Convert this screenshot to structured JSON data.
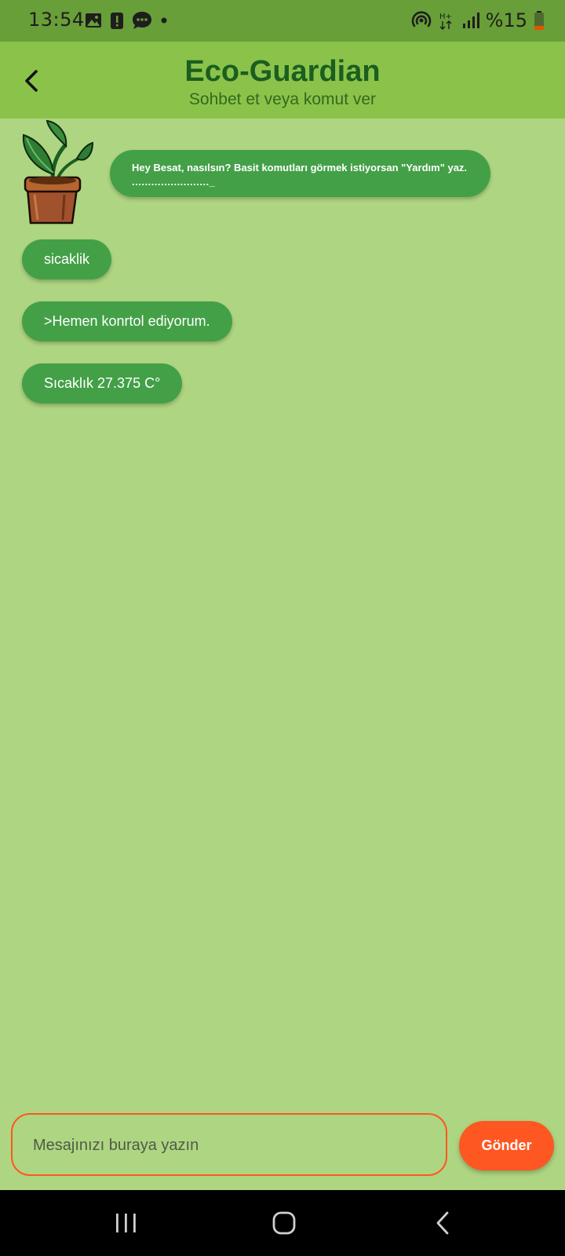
{
  "status_bar": {
    "time": "13:54",
    "battery": "%15",
    "network": "H+",
    "icons_left": [
      "image-icon",
      "alert-icon",
      "chat-icon",
      "dot-icon"
    ],
    "icons_right": [
      "hotspot-icon",
      "network-type-icon",
      "signal-icon",
      "battery-icon"
    ]
  },
  "header": {
    "title": "Eco-Guardian",
    "subtitle": "Sohbet et veya komut ver"
  },
  "chat": {
    "bot_greeting": "Hey Besat, nasılsın? Basit komutları görmek istiyorsan \"Yardım\" yaz.",
    "bot_greeting_trail": "........................_",
    "messages": [
      {
        "text": "sicaklik"
      },
      {
        "text": ">Hemen konrtol ediyorum."
      },
      {
        "text": "Sıcaklık 27.375 C°"
      }
    ]
  },
  "composer": {
    "placeholder": "Mesajınızı buraya yazın",
    "send_label": "Gönder"
  },
  "colors": {
    "background": "#aed581",
    "app_bar": "#8bc34a",
    "status_bar": "#689f38",
    "bubble": "#43a047",
    "accent": "#ff5722",
    "title": "#1b5e20"
  }
}
